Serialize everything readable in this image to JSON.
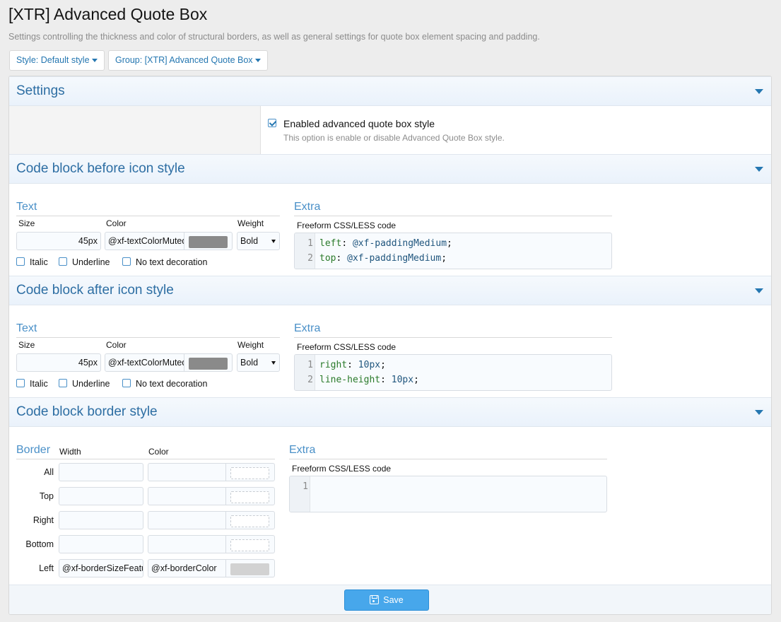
{
  "page": {
    "title": "[XTR] Advanced Quote Box",
    "description": "Settings controlling the thickness and color of structural borders, as well as general settings for quote box element spacing and padding."
  },
  "filters": {
    "style_label": "Style: Default style",
    "group_label": "Group: [XTR] Advanced Quote Box"
  },
  "sections": {
    "settings": {
      "title": "Settings",
      "option_label": "Enabled advanced quote box style",
      "option_hint": "This option is enable or disable Advanced Quote Box style.",
      "option_checked": true
    },
    "before_icon": {
      "title": "Code block before icon style",
      "text_heading": "Text",
      "size_label": "Size",
      "size_value": "45px",
      "color_label": "Color",
      "color_value": "@xf-textColorMuted",
      "color_swatch": "#8a8a8a",
      "weight_label": "Weight",
      "weight_value": "Bold",
      "italic_label": "Italic",
      "underline_label": "Underline",
      "no_decoration_label": "No text decoration",
      "extra_heading": "Extra",
      "code_label": "Freeform CSS/LESS code",
      "code_lines": [
        {
          "num": "1",
          "prop": "left",
          "value": "@xf-paddingMedium"
        },
        {
          "num": "2",
          "prop": "top",
          "value": "@xf-paddingMedium"
        }
      ]
    },
    "after_icon": {
      "title": "Code block after icon style",
      "text_heading": "Text",
      "size_label": "Size",
      "size_value": "45px",
      "color_label": "Color",
      "color_value": "@xf-textColorMuted",
      "color_swatch": "#8a8a8a",
      "weight_label": "Weight",
      "weight_value": "Bold",
      "italic_label": "Italic",
      "underline_label": "Underline",
      "no_decoration_label": "No text decoration",
      "extra_heading": "Extra",
      "code_label": "Freeform CSS/LESS code",
      "code_lines": [
        {
          "num": "1",
          "prop": "right",
          "value": "10px"
        },
        {
          "num": "2",
          "prop": "line-height",
          "value": "10px"
        }
      ]
    },
    "border": {
      "title": "Code block border style",
      "border_heading": "Border",
      "width_label": "Width",
      "color_label": "Color",
      "rows": [
        {
          "label": "All",
          "width": "",
          "color": ""
        },
        {
          "label": "Top",
          "width": "",
          "color": ""
        },
        {
          "label": "Right",
          "width": "",
          "color": ""
        },
        {
          "label": "Bottom",
          "width": "",
          "color": ""
        },
        {
          "label": "Left",
          "width": "@xf-borderSizeFeature",
          "color": "@xf-borderColor"
        }
      ],
      "extra_heading": "Extra",
      "code_label": "Freeform CSS/LESS code",
      "code_line_num": "1"
    }
  },
  "footer": {
    "save_label": "Save"
  },
  "colors": {
    "accent": "#2577b1",
    "header_text": "#2d6ea3",
    "save_button": "#47a7eb"
  },
  "icons": [
    "chevron-down-icon",
    "checkbox-icon",
    "save-icon"
  ]
}
